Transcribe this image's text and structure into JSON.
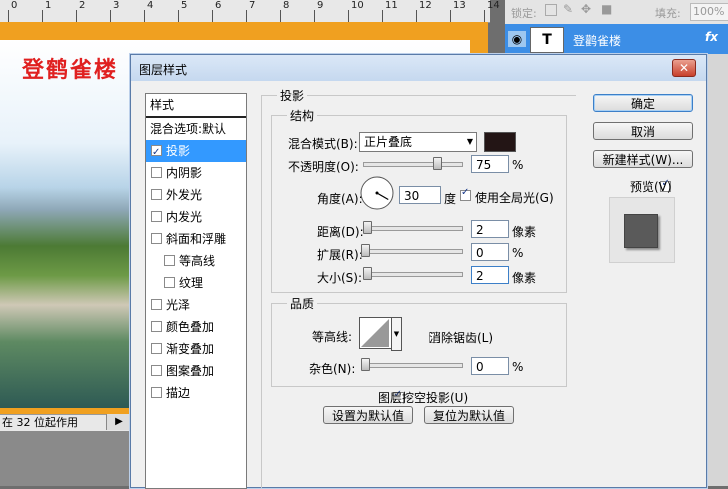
{
  "background": {
    "ruler_numbers": [
      "0",
      "1",
      "2",
      "3",
      "4",
      "5",
      "6",
      "7",
      "8",
      "9",
      "10",
      "11",
      "12",
      "13",
      "14"
    ],
    "photo_title": "登鹤雀楼",
    "status_text": "在 32 位起作用",
    "status_arrow": "▶"
  },
  "layers_panel": {
    "lock_label": "锁定:",
    "fill_label": "填充:",
    "fill_value": "100%",
    "layer_thumb_glyph": "T",
    "layer_name": "登鹳雀楼",
    "fx_label": "fx",
    "eye_icon": "eye-icon"
  },
  "dialog": {
    "title": "图层样式",
    "close_glyph": "✕",
    "sidebar": {
      "header": "样式",
      "items": [
        {
          "label": "混合选项:默认",
          "checkbox": false,
          "checked": false,
          "selected": false,
          "indent": false
        },
        {
          "label": "投影",
          "checkbox": true,
          "checked": true,
          "selected": true,
          "indent": false
        },
        {
          "label": "内阴影",
          "checkbox": true,
          "checked": false,
          "selected": false,
          "indent": false
        },
        {
          "label": "外发光",
          "checkbox": true,
          "checked": false,
          "selected": false,
          "indent": false
        },
        {
          "label": "内发光",
          "checkbox": true,
          "checked": false,
          "selected": false,
          "indent": false
        },
        {
          "label": "斜面和浮雕",
          "checkbox": true,
          "checked": false,
          "selected": false,
          "indent": false
        },
        {
          "label": "等高线",
          "checkbox": true,
          "checked": false,
          "selected": false,
          "indent": true
        },
        {
          "label": "纹理",
          "checkbox": true,
          "checked": false,
          "selected": false,
          "indent": true
        },
        {
          "label": "光泽",
          "checkbox": true,
          "checked": false,
          "selected": false,
          "indent": false
        },
        {
          "label": "颜色叠加",
          "checkbox": true,
          "checked": false,
          "selected": false,
          "indent": false
        },
        {
          "label": "渐变叠加",
          "checkbox": true,
          "checked": false,
          "selected": false,
          "indent": false
        },
        {
          "label": "图案叠加",
          "checkbox": true,
          "checked": false,
          "selected": false,
          "indent": false
        },
        {
          "label": "描边",
          "checkbox": true,
          "checked": false,
          "selected": false,
          "indent": false
        }
      ]
    },
    "drop_shadow": {
      "group_title": "投影",
      "structure_title": "结构",
      "blend_mode_label": "混合模式(B):",
      "blend_mode_value": "正片叠底",
      "shadow_color": "#231515",
      "opacity_label": "不透明度(O):",
      "opacity_value": "75",
      "opacity_unit": "%",
      "opacity_fraction": 0.75,
      "angle_label": "角度(A):",
      "angle_value": "30",
      "angle_unit": "度",
      "global_light_label": "使用全局光(G)",
      "global_light_checked": true,
      "distance_label": "距离(D):",
      "distance_value": "2",
      "distance_unit": "像素",
      "spread_label": "扩展(R):",
      "spread_value": "0",
      "spread_unit": "%",
      "size_label": "大小(S):",
      "size_value": "2",
      "size_unit": "像素",
      "quality_title": "品质",
      "contour_label": "等高线:",
      "antialias_label": "消除锯齿(L)",
      "antialias_checked": false,
      "noise_label": "杂色(N):",
      "noise_value": "0",
      "noise_unit": "%",
      "knockout_label": "图层挖空投影(U)",
      "knockout_checked": true,
      "make_default_label": "设置为默认值",
      "reset_default_label": "复位为默认值"
    },
    "buttons": {
      "ok": "确定",
      "cancel": "取消",
      "new_style": "新建样式(W)...",
      "preview_label": "预览(V)",
      "preview_checked": true
    }
  },
  "colors": {
    "selection": "#3399ff",
    "canvas_border": "#f0a020",
    "title_red": "#e02020"
  }
}
